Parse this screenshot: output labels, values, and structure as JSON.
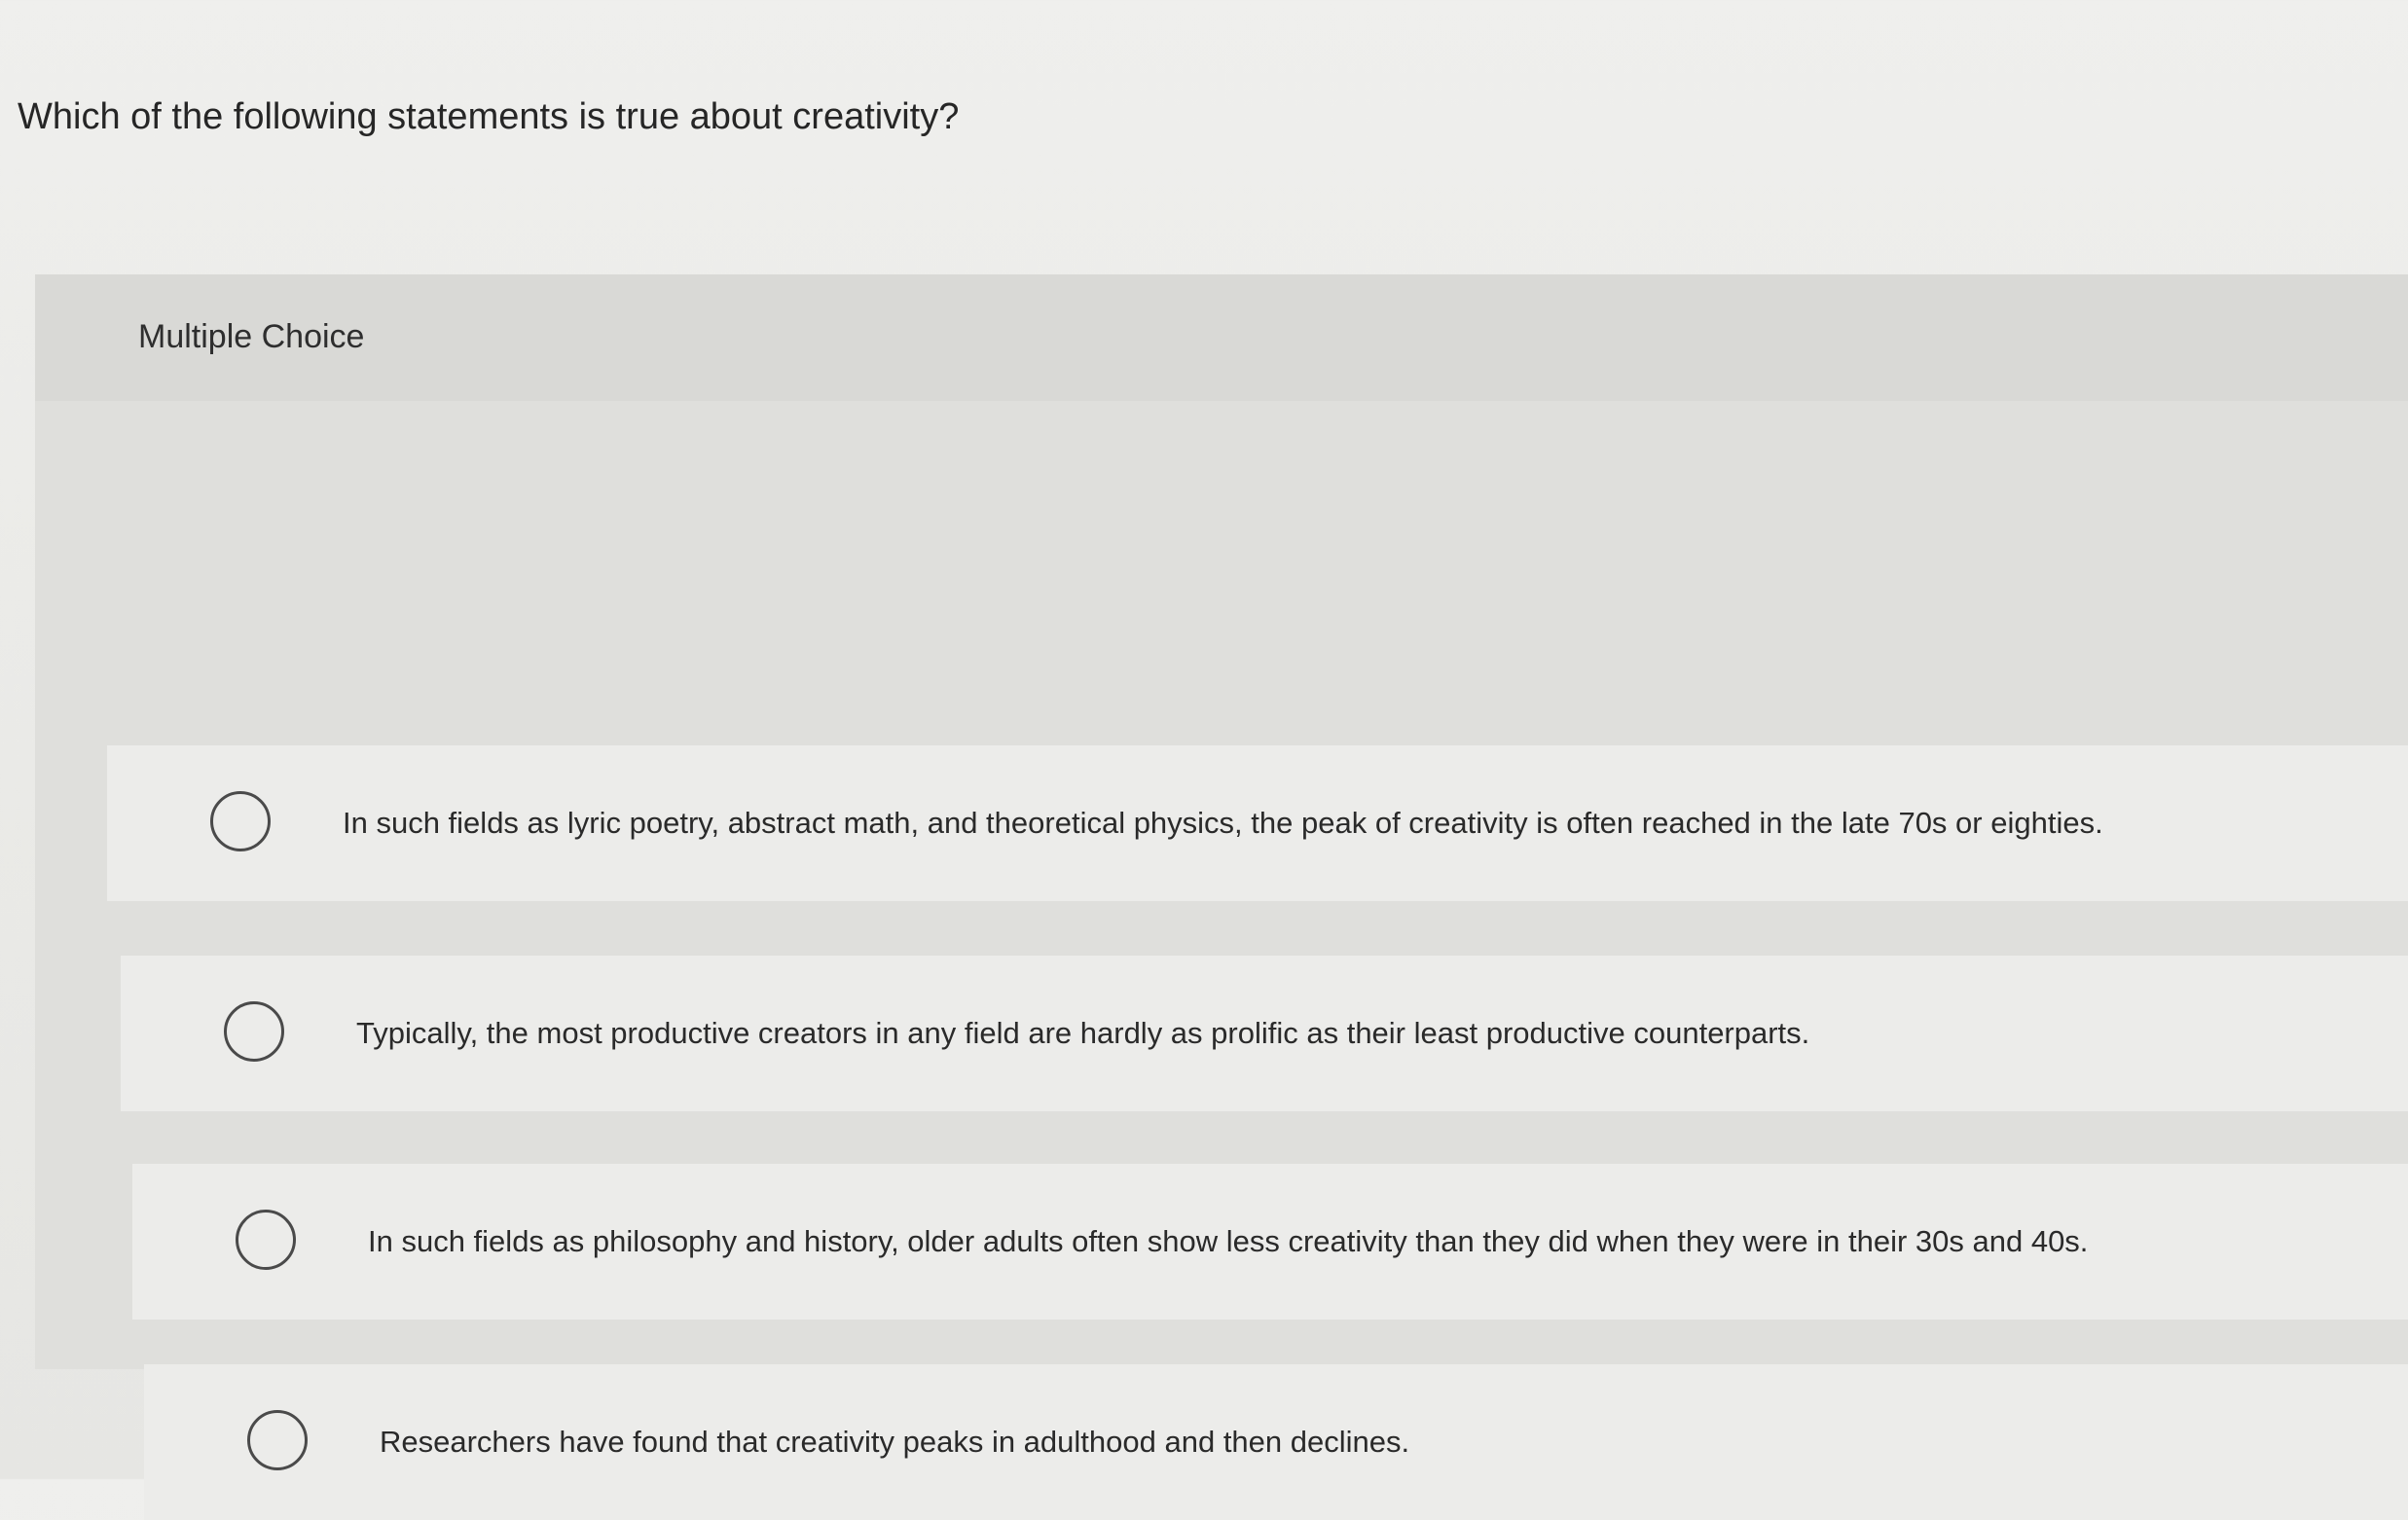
{
  "question": {
    "text": "Which of the following statements is true about creativity?"
  },
  "multiple_choice": {
    "label": "Multiple Choice",
    "choices": [
      {
        "text": "In such fields as lyric poetry, abstract math, and theoretical physics, the peak of creativity is often reached in the late 70s or eighties.",
        "selected": false
      },
      {
        "text": "Typically, the most productive creators in any field are hardly as prolific as their least productive counterparts.",
        "selected": false
      },
      {
        "text": "In such fields as philosophy and history, older adults often show less creativity than they did when they were in their 30s and 40s.",
        "selected": false
      },
      {
        "text": "Researchers have found that creativity peaks in adulthood and then declines.",
        "selected": false
      }
    ]
  }
}
